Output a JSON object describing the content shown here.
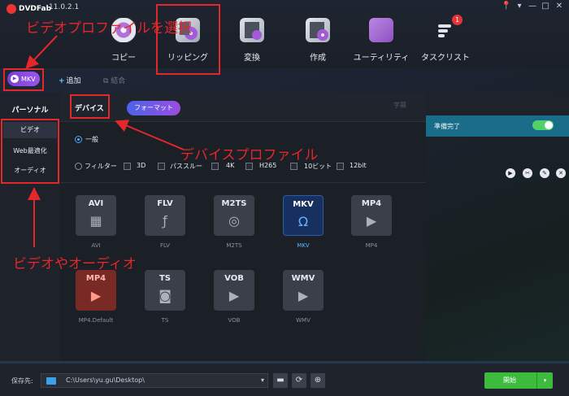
{
  "app": {
    "logo_text": "DVDFab",
    "version": "11.0.2.1"
  },
  "window_controls": [
    "📍",
    "▾",
    "—",
    "□",
    "✕"
  ],
  "toolbar": [
    {
      "id": "copy",
      "label": "コピー",
      "icon": "disc-icon"
    },
    {
      "id": "ripper",
      "label": "リッピング",
      "icon": "ripper-icon"
    },
    {
      "id": "convert",
      "label": "変換",
      "icon": "film-icon"
    },
    {
      "id": "create",
      "label": "作成",
      "icon": "film-disc-icon"
    },
    {
      "id": "utility",
      "label": "ユーティリティ",
      "icon": "utility-icon"
    },
    {
      "id": "tasks",
      "label": "タスクリスト",
      "icon": "task-list-icon"
    }
  ],
  "task_badge": "1",
  "source_chip": {
    "label": "MKV"
  },
  "add_button": {
    "plus": "+",
    "label": "追加"
  },
  "merge_button": {
    "label": "結合"
  },
  "left_panel": {
    "title": "パーソナル",
    "items": [
      {
        "label": "ビデオ",
        "active": true
      },
      {
        "label": "Web最適化",
        "active": false
      },
      {
        "label": "オーディオ",
        "active": false
      }
    ]
  },
  "tabs": {
    "device": "デバイス",
    "format": "フォーマット",
    "quality": "字幕"
  },
  "options": {
    "general": "一般",
    "filter": "フィルター",
    "checks": [
      "3D",
      "パススルー",
      "4K",
      "H265",
      "10ビット",
      "12bit"
    ]
  },
  "formats": [
    {
      "code": "AVI",
      "symbol": "▦",
      "name": "AVI",
      "style": "normal"
    },
    {
      "code": "FLV",
      "symbol": "ƒ",
      "name": "FLV",
      "style": "normal"
    },
    {
      "code": "M2TS",
      "symbol": "◎",
      "name": "M2TS",
      "style": "normal"
    },
    {
      "code": "MKV",
      "symbol": "Ω",
      "name": "MKV",
      "style": "selected"
    },
    {
      "code": "MP4",
      "symbol": "▶",
      "name": "MP4",
      "style": "normal"
    },
    {
      "code": "MP4",
      "symbol": "▶",
      "name": "MP4.Default",
      "style": "mp4def"
    },
    {
      "code": "TS",
      "symbol": "◙",
      "name": "TS",
      "style": "normal"
    },
    {
      "code": "VOB",
      "symbol": "▶",
      "name": "VOB",
      "style": "normal"
    },
    {
      "code": "WMV",
      "symbol": "▶",
      "name": "WMV",
      "style": "normal"
    }
  ],
  "status": {
    "text": "準備完了",
    "toggle_on": true
  },
  "right_icons": [
    "▶",
    "✂",
    "✎",
    "✕"
  ],
  "bottom": {
    "save_label": "保存先:",
    "path": "C:\\Users\\yu.gu\\Desktop\\",
    "path_arrow": "▾",
    "icons": [
      "▬",
      "⟳",
      "⊕"
    ],
    "start_label": "開始",
    "start_arrow": "▾"
  },
  "annotations": {
    "select_video_profile": "ビデオプロファイルを選択",
    "device_profile": "デバイスプロファイル",
    "video_or_audio": "ビデオやオーディオ"
  },
  "colors": {
    "annotation_red": "#e3272a",
    "accent_purple": "#8a4be0",
    "start_green": "#3dbb3d",
    "status_teal": "#1a6d88"
  }
}
